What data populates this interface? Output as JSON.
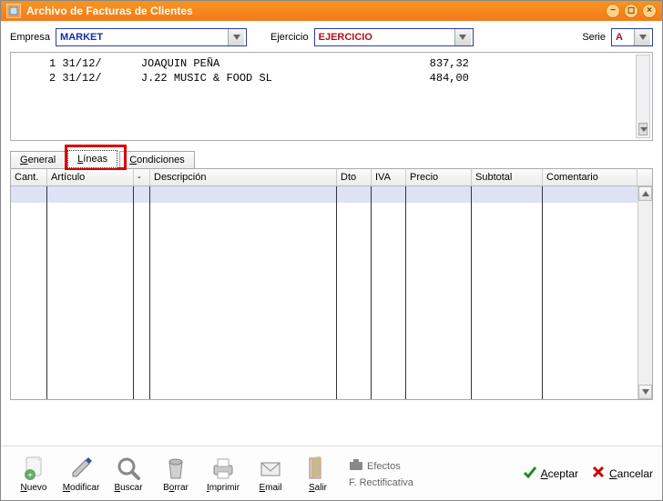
{
  "title": "Archivo de Facturas de Clientes",
  "filters": {
    "empresa_label": "Empresa",
    "empresa_value": "MARKET",
    "ejercicio_label": "Ejercicio",
    "ejercicio_value": "EJERCICIO",
    "serie_label": "Serie",
    "serie_value": "A"
  },
  "listing": [
    {
      "num": "1",
      "date": "31/12/",
      "name": "JOAQUIN PEÑA",
      "amount": "837,32"
    },
    {
      "num": "2",
      "date": "31/12/",
      "name": "J.22 MUSIC & FOOD SL",
      "amount": "484,00"
    }
  ],
  "tabs": {
    "general": "General",
    "lineas": "Líneas",
    "condiciones": "Condiciones"
  },
  "grid_headers": {
    "cant": "Cant.",
    "articulo": "Artículo",
    "dash": "-",
    "descripcion": "Descripción",
    "dto": "Dto",
    "iva": "IVA",
    "precio": "Precio",
    "subtotal": "Subtotal",
    "comentario": "Comentario"
  },
  "toolbar": {
    "nuevo": "Nuevo",
    "modificar": "Modificar",
    "buscar": "Buscar",
    "borrar": "Borrar",
    "imprimir": "Imprimir",
    "email": "Email",
    "salir": "Salir",
    "efectos": "Efectos",
    "rectificativa": "F. Rectificativa",
    "aceptar": "Aceptar",
    "cancelar": "Cancelar"
  }
}
